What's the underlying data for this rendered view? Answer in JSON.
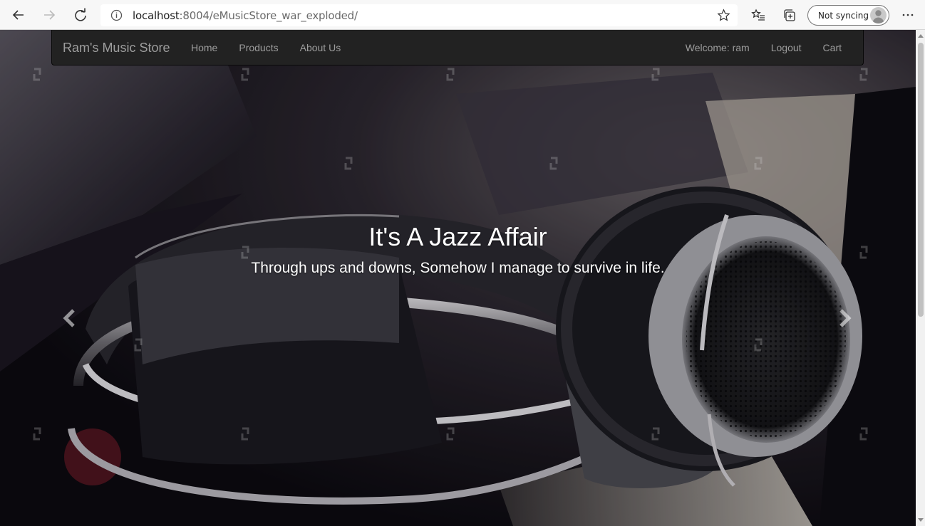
{
  "browser": {
    "url_host": "localhost",
    "url_path": ":8004/eMusicStore_war_exploded/",
    "sync_label": "Not syncing"
  },
  "navbar": {
    "brand": "Ram's Music Store",
    "left_links": [
      "Home",
      "Products",
      "About Us"
    ],
    "welcome": "Welcome: ram",
    "logout": "Logout",
    "cart": "Cart"
  },
  "carousel": {
    "heading": "It's A Jazz Affair",
    "subheading": "Through ups and downs, Somehow I manage to survive in life."
  },
  "colors": {
    "navbar_bg": "#222222",
    "navbar_link": "#9d9d9d"
  }
}
